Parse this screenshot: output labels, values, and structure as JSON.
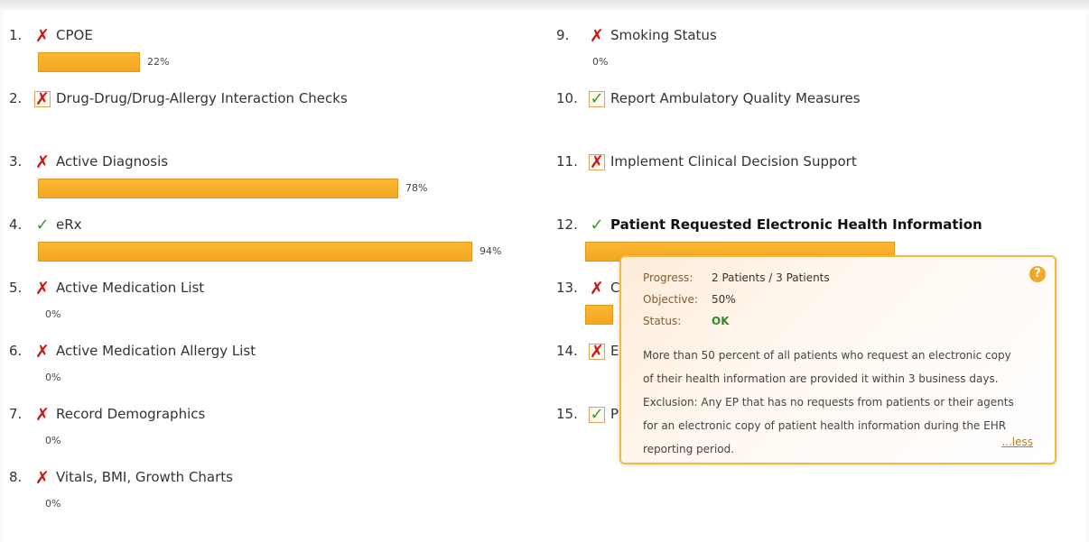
{
  "items": [
    {
      "num": "1.",
      "label": "CPOE",
      "status": "fail",
      "boxed": false,
      "progress": 22,
      "pct": "22%",
      "bold": false
    },
    {
      "num": "2.",
      "label": "Drug-Drug/Drug-Allergy Interaction Checks",
      "status": "fail",
      "boxed": true,
      "progress": null,
      "pct": "",
      "bold": false
    },
    {
      "num": "3.",
      "label": "Active Diagnosis",
      "status": "fail",
      "boxed": false,
      "progress": 78,
      "pct": "78%",
      "bold": false
    },
    {
      "num": "4.",
      "label": "eRx",
      "status": "pass",
      "boxed": false,
      "progress": 94,
      "pct": "94%",
      "bold": false
    },
    {
      "num": "5.",
      "label": "Active Medication List",
      "status": "fail",
      "boxed": false,
      "progress": 0,
      "pct": "0%",
      "bold": false
    },
    {
      "num": "6.",
      "label": "Active Medication Allergy List",
      "status": "fail",
      "boxed": false,
      "progress": 0,
      "pct": "0%",
      "bold": false
    },
    {
      "num": "7.",
      "label": "Record Demographics",
      "status": "fail",
      "boxed": false,
      "progress": 0,
      "pct": "0%",
      "bold": false
    },
    {
      "num": "8.",
      "label": "Vitals, BMI, Growth Charts",
      "status": "fail",
      "boxed": false,
      "progress": 0,
      "pct": "0%",
      "bold": false
    },
    {
      "num": "9.",
      "label": "Smoking Status",
      "status": "fail",
      "boxed": false,
      "progress": 0,
      "pct": "0%",
      "bold": false
    },
    {
      "num": "10.",
      "label": "Report Ambulatory Quality Measures",
      "status": "pass",
      "boxed": true,
      "progress": null,
      "pct": "",
      "bold": false
    },
    {
      "num": "11.",
      "label": "Implement Clinical Decision Support",
      "status": "fail",
      "boxed": true,
      "progress": null,
      "pct": "",
      "bold": false
    },
    {
      "num": "12.",
      "label": "Patient Requested Electronic Health Information",
      "status": "pass",
      "boxed": false,
      "progress": 67,
      "pct": "",
      "bold": true
    },
    {
      "num": "13.",
      "label": "Cli",
      "status": "fail",
      "boxed": false,
      "progress": 6,
      "pct": "",
      "bold": false
    },
    {
      "num": "14.",
      "label": "Ele",
      "status": "fail",
      "boxed": true,
      "progress": null,
      "pct": "",
      "bold": false
    },
    {
      "num": "15.",
      "label": "Pr",
      "status": "pass",
      "boxed": true,
      "progress": null,
      "pct": "",
      "bold": false
    }
  ],
  "tooltip": {
    "progress_label": "Progress:",
    "progress_value": "2 Patients / 3 Patients",
    "objective_label": "Objective:",
    "objective_value": "50%",
    "status_label": "Status:",
    "status_value": "OK",
    "description": "More than 50 percent of all patients who request an electronic copy of their health information are provided it within 3 business days. Exclusion: Any EP that has no requests from patients or their agents for an electronic copy of patient health information during the EHR reporting period.",
    "less_link": "...less",
    "help_icon": "?"
  },
  "icons": {
    "fail": "red-x-icon",
    "pass": "green-check-icon"
  },
  "colors": {
    "bar": "#f5a623",
    "fail": "#cc1414",
    "pass": "#3a9b2a",
    "tooltip_border": "#f2b843"
  }
}
